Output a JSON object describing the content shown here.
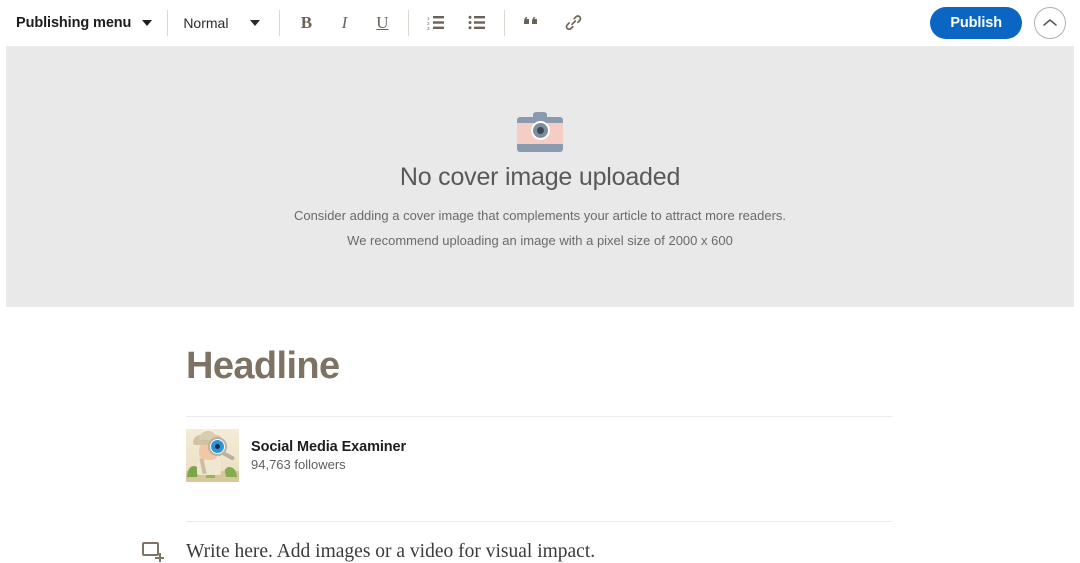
{
  "toolbar": {
    "publishing_menu_label": "Publishing menu",
    "publishing_menu_caret": "chevron-down-icon",
    "text_style_label": "Normal",
    "text_style_caret": "chevron-down-icon",
    "format_buttons": [
      {
        "name": "bold",
        "glyph": "B"
      },
      {
        "name": "italic",
        "glyph": "I"
      },
      {
        "name": "underline",
        "glyph": "U"
      }
    ],
    "list_buttons": [
      {
        "name": "ordered-list-icon"
      },
      {
        "name": "unordered-list-icon"
      }
    ],
    "misc_buttons": [
      {
        "name": "blockquote-icon"
      },
      {
        "name": "link-icon"
      }
    ],
    "publish_label": "Publish",
    "publish_color": "#0a66c2",
    "collapse_icon": "chevron-up-icon"
  },
  "cover": {
    "icon": "camera-icon",
    "title": "No cover image uploaded",
    "subtitle_line1": "Consider adding a cover image that complements your article to attract more readers.",
    "subtitle_line2": "We recommend uploading an image with a pixel size of 2000 x 600",
    "background_color": "#e9e9e9"
  },
  "article": {
    "headline_placeholder": "Headline",
    "author": {
      "avatar": "social-media-examiner-avatar",
      "name": "Social Media Examiner",
      "followers": "94,763 followers"
    },
    "body_add_icon": "add-content-block-icon",
    "body_placeholder": "Write here. Add images or a video for visual impact."
  }
}
